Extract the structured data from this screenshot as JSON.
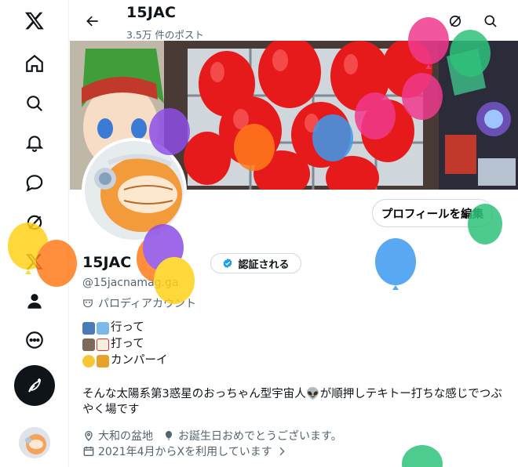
{
  "header": {
    "title": "15JAC",
    "post_count": "3.5万 件のポスト"
  },
  "profile": {
    "display_name": "15JAC",
    "verify_label": "認証される",
    "handle": "@15jacnamag.ga",
    "parody_label": "パロディアカウント",
    "edit_label": "プロフィールを編集",
    "bio_lines": [
      "行って",
      "打って",
      "カンパーイ"
    ],
    "description": "そんな太陽系第3惑星のおっちゃん型宇宙人👽が順押しテキトー打ちな感じでつぶやく場です",
    "location": "大和の盆地",
    "birthday": "お誕生日おめでとうございます。",
    "joined": "2021年4月からXを利用しています"
  },
  "icons": {
    "nav": [
      "x-logo-icon",
      "home-icon",
      "search-icon",
      "notifications-icon",
      "messages-icon",
      "grok-icon",
      "premium-x-icon",
      "profile-icon",
      "more-icon"
    ],
    "compose": "compose-feather-icon"
  },
  "colors": {
    "accent": "#1d9bf0",
    "text": "#0f1419",
    "muted": "#536471"
  }
}
